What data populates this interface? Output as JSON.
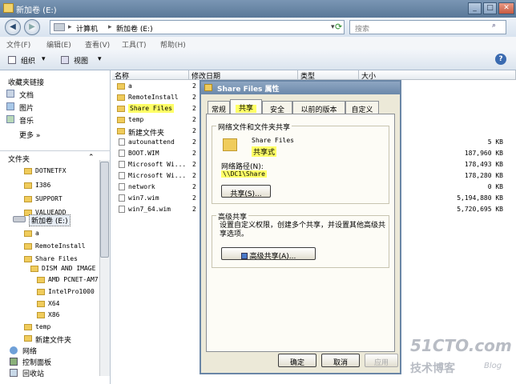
{
  "window": {
    "title": "新加卷 (E:)"
  },
  "address": {
    "part1": "计算机",
    "sep": "▸",
    "part2": "新加卷 (E:)"
  },
  "search": {
    "placeholder": "搜索"
  },
  "menu": [
    "文件(F)",
    "编辑(E)",
    "查看(V)",
    "工具(T)",
    "帮助(H)"
  ],
  "toolbar": {
    "organize": "组织",
    "view": "视图"
  },
  "favorites": {
    "header": "收藏夹链接",
    "items": [
      "文档",
      "图片",
      "音乐"
    ],
    "more": "更多 »"
  },
  "folders": {
    "header": "文件夹",
    "tree": [
      "DOTNETFX",
      "I386",
      "SUPPORT",
      "VALUEADD",
      "新加卷 (E:)",
      "a",
      "RemoteInstall",
      "Share Files",
      "DISM AND IMAGE",
      "AMD PCNET-AM7",
      "IntelPro1000",
      "X64",
      "X86",
      "temp",
      "新建文件夹",
      "网络",
      "控制面板",
      "回收站"
    ]
  },
  "filelist": {
    "columns": [
      "名称",
      "修改日期",
      "类型",
      "大小"
    ],
    "rows": [
      {
        "name": "a",
        "size": ""
      },
      {
        "name": "RemoteInstall",
        "size": ""
      },
      {
        "name": "Share Files",
        "size": ""
      },
      {
        "name": "temp",
        "size": ""
      },
      {
        "name": "新建文件夹",
        "size": ""
      },
      {
        "name": "autounattend",
        "size": "5 KB"
      },
      {
        "name": "BOOT.WIM",
        "size": "187,960 KB"
      },
      {
        "name": "Microsoft Wi...",
        "size": "178,493 KB"
      },
      {
        "name": "Microsoft Wi...",
        "size": "178,280 KB"
      },
      {
        "name": "network",
        "size": "0 KB"
      },
      {
        "name": "win7.wim",
        "size": "5,194,880 KB"
      },
      {
        "name": "win7_64.wim",
        "size": "5,720,695 KB"
      }
    ],
    "date_prefix": "2"
  },
  "dialog": {
    "title": "Share Files 属性",
    "tabs": [
      "常规",
      "共享",
      "安全",
      "以前的版本",
      "自定义"
    ],
    "share_group_label": "网络文件和文件夹共享",
    "folder_name": "Share Files",
    "share_state": "共享式",
    "net_path_label": "网络路径(N):",
    "net_path": "\\\\DC1\\Share",
    "share_button": "共享(S)...",
    "adv_group_label": "高级共享",
    "adv_desc": "设置自定义权限，创建多个共享，并设置其他高级共享选项。",
    "adv_button": "高级共享(A)...",
    "ok": "确定",
    "cancel": "取消",
    "apply": "应用"
  },
  "watermark": {
    "site": "51CTO.com",
    "sub": "技术博客",
    "blog": "Blog"
  },
  "colors": {
    "highlight": "#ffff66",
    "title": "#6b88aa",
    "dialog_bg": "#ece9d8"
  }
}
